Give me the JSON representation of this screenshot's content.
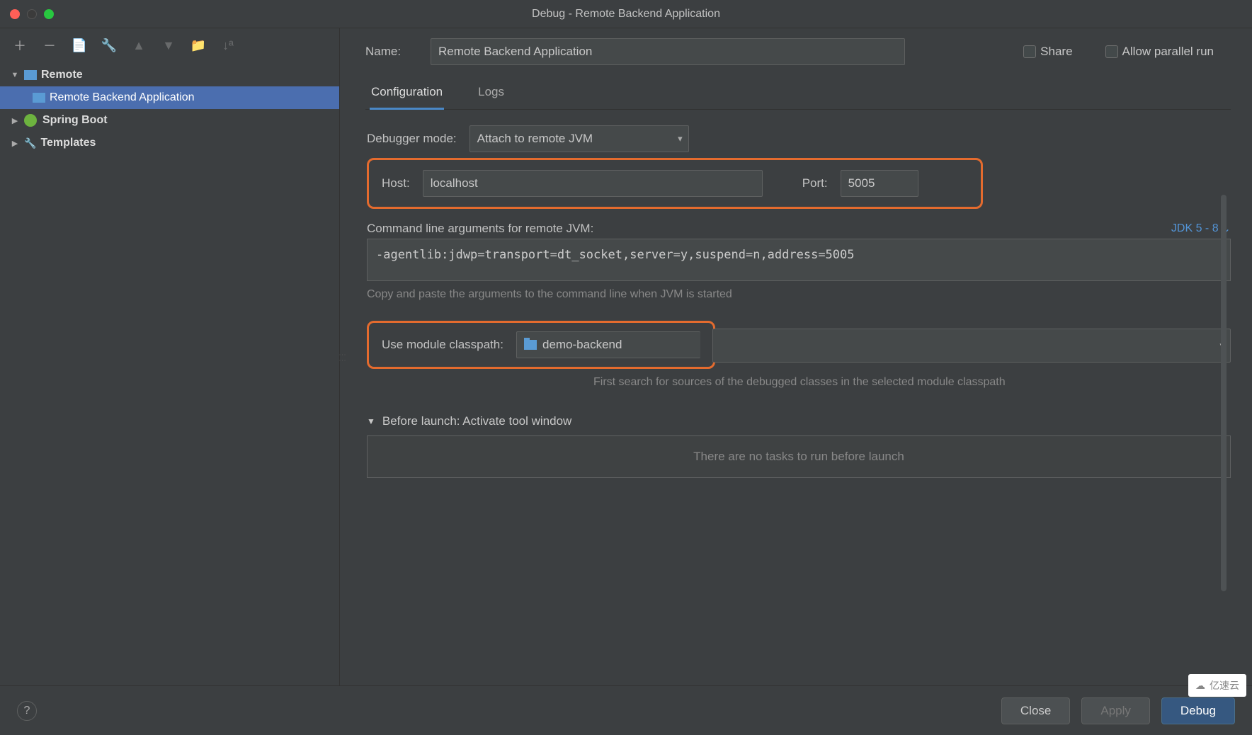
{
  "title": "Debug - Remote Backend Application",
  "sidebar": {
    "items": [
      {
        "label": "Remote",
        "expanded": true,
        "bold": true
      },
      {
        "label": "Remote Backend Application",
        "selected": true,
        "child": true
      },
      {
        "label": "Spring Boot",
        "bold": true
      },
      {
        "label": "Templates",
        "bold": true
      }
    ]
  },
  "form": {
    "name_label": "Name:",
    "name_value": "Remote Backend Application",
    "share_label": "Share",
    "parallel_label": "Allow parallel run"
  },
  "tabs": {
    "configuration": "Configuration",
    "logs": "Logs"
  },
  "config": {
    "debugger_mode_label": "Debugger mode:",
    "debugger_mode_value": "Attach to remote JVM",
    "host_label": "Host:",
    "host_value": "localhost",
    "port_label": "Port:",
    "port_value": "5005",
    "cmd_label": "Command line arguments for remote JVM:",
    "jdk_label": "JDK 5 - 8",
    "cmd_value": "-agentlib:jdwp=transport=dt_socket,server=y,suspend=n,address=5005",
    "cmd_hint": "Copy and paste the arguments to the command line when JVM is started",
    "module_label": "Use module classpath:",
    "module_value": "demo-backend",
    "module_hint": "First search for sources of the debugged classes in the selected module classpath",
    "before_label": "Before launch: Activate tool window",
    "before_empty": "There are no tasks to run before launch"
  },
  "footer": {
    "close": "Close",
    "apply": "Apply",
    "debug": "Debug"
  },
  "watermark": "亿速云"
}
